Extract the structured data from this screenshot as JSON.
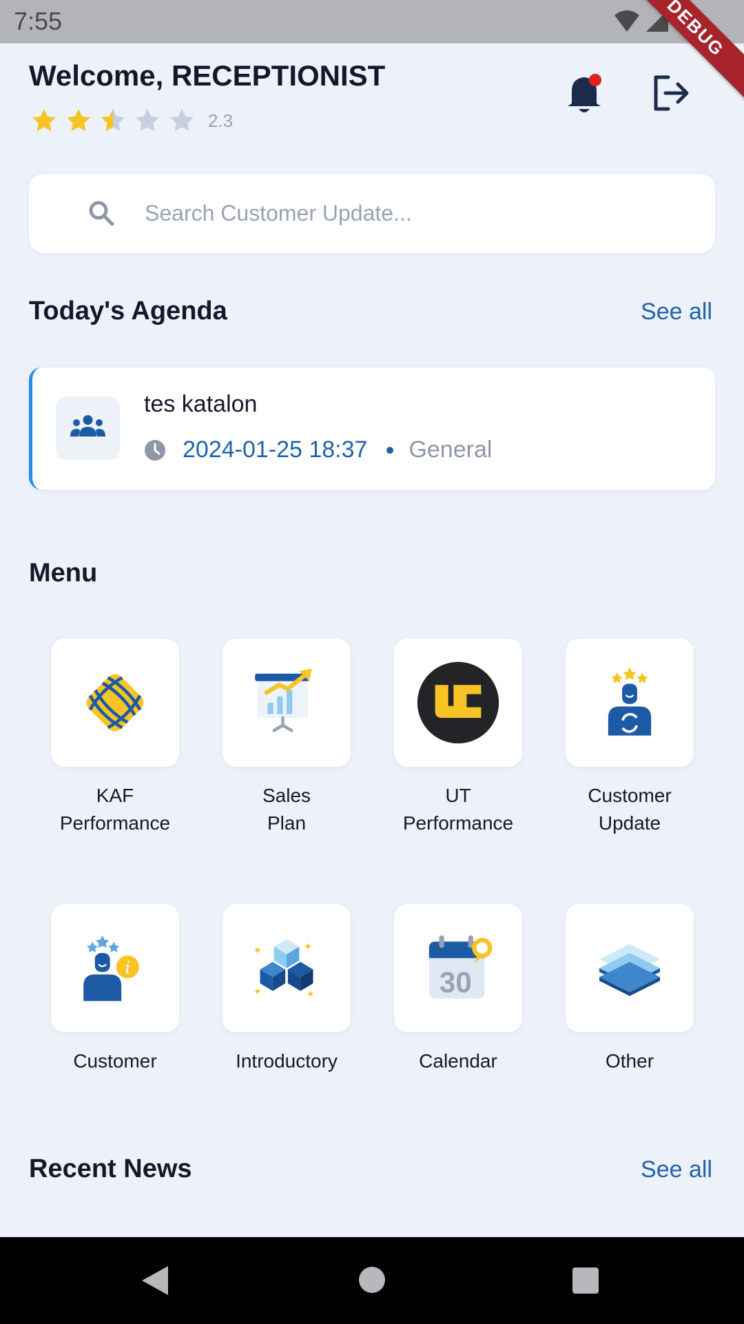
{
  "status_bar": {
    "time": "7:55",
    "debug_label": "DEBUG"
  },
  "header": {
    "welcome": "Welcome, RECEPTIONIST",
    "rating_value": "2.3",
    "rating": 2.3,
    "rating_max": 5
  },
  "search": {
    "placeholder": "Search Customer Update..."
  },
  "agenda": {
    "title": "Today's Agenda",
    "see_all": "See all",
    "items": [
      {
        "title": "tes katalon",
        "datetime": "2024-01-25 18:37",
        "type": "General",
        "icon": "people-icon"
      }
    ]
  },
  "menu": {
    "title": "Menu",
    "items": [
      {
        "label": "KAF\nPerformance",
        "icon": "kaf-logo-icon"
      },
      {
        "label": "Sales\nPlan",
        "icon": "sales-plan-chart-icon"
      },
      {
        "label": "UT\nPerformance",
        "icon": "ut-logo-icon"
      },
      {
        "label": "Customer\nUpdate",
        "icon": "customer-update-icon"
      },
      {
        "label": "Customer",
        "icon": "customer-info-icon"
      },
      {
        "label": "Introductory",
        "icon": "cubes-icon"
      },
      {
        "label": "Calendar",
        "icon": "calendar-icon",
        "calendar_day": "30"
      },
      {
        "label": "Other",
        "icon": "layers-icon"
      }
    ]
  },
  "news": {
    "title": "Recent News",
    "see_all": "See all"
  },
  "colors": {
    "accent": "#1d63ad",
    "star": "#f7c325",
    "star_empty": "#c5cfdf",
    "background": "#edf1f9",
    "notification_dot": "#e0221f"
  }
}
